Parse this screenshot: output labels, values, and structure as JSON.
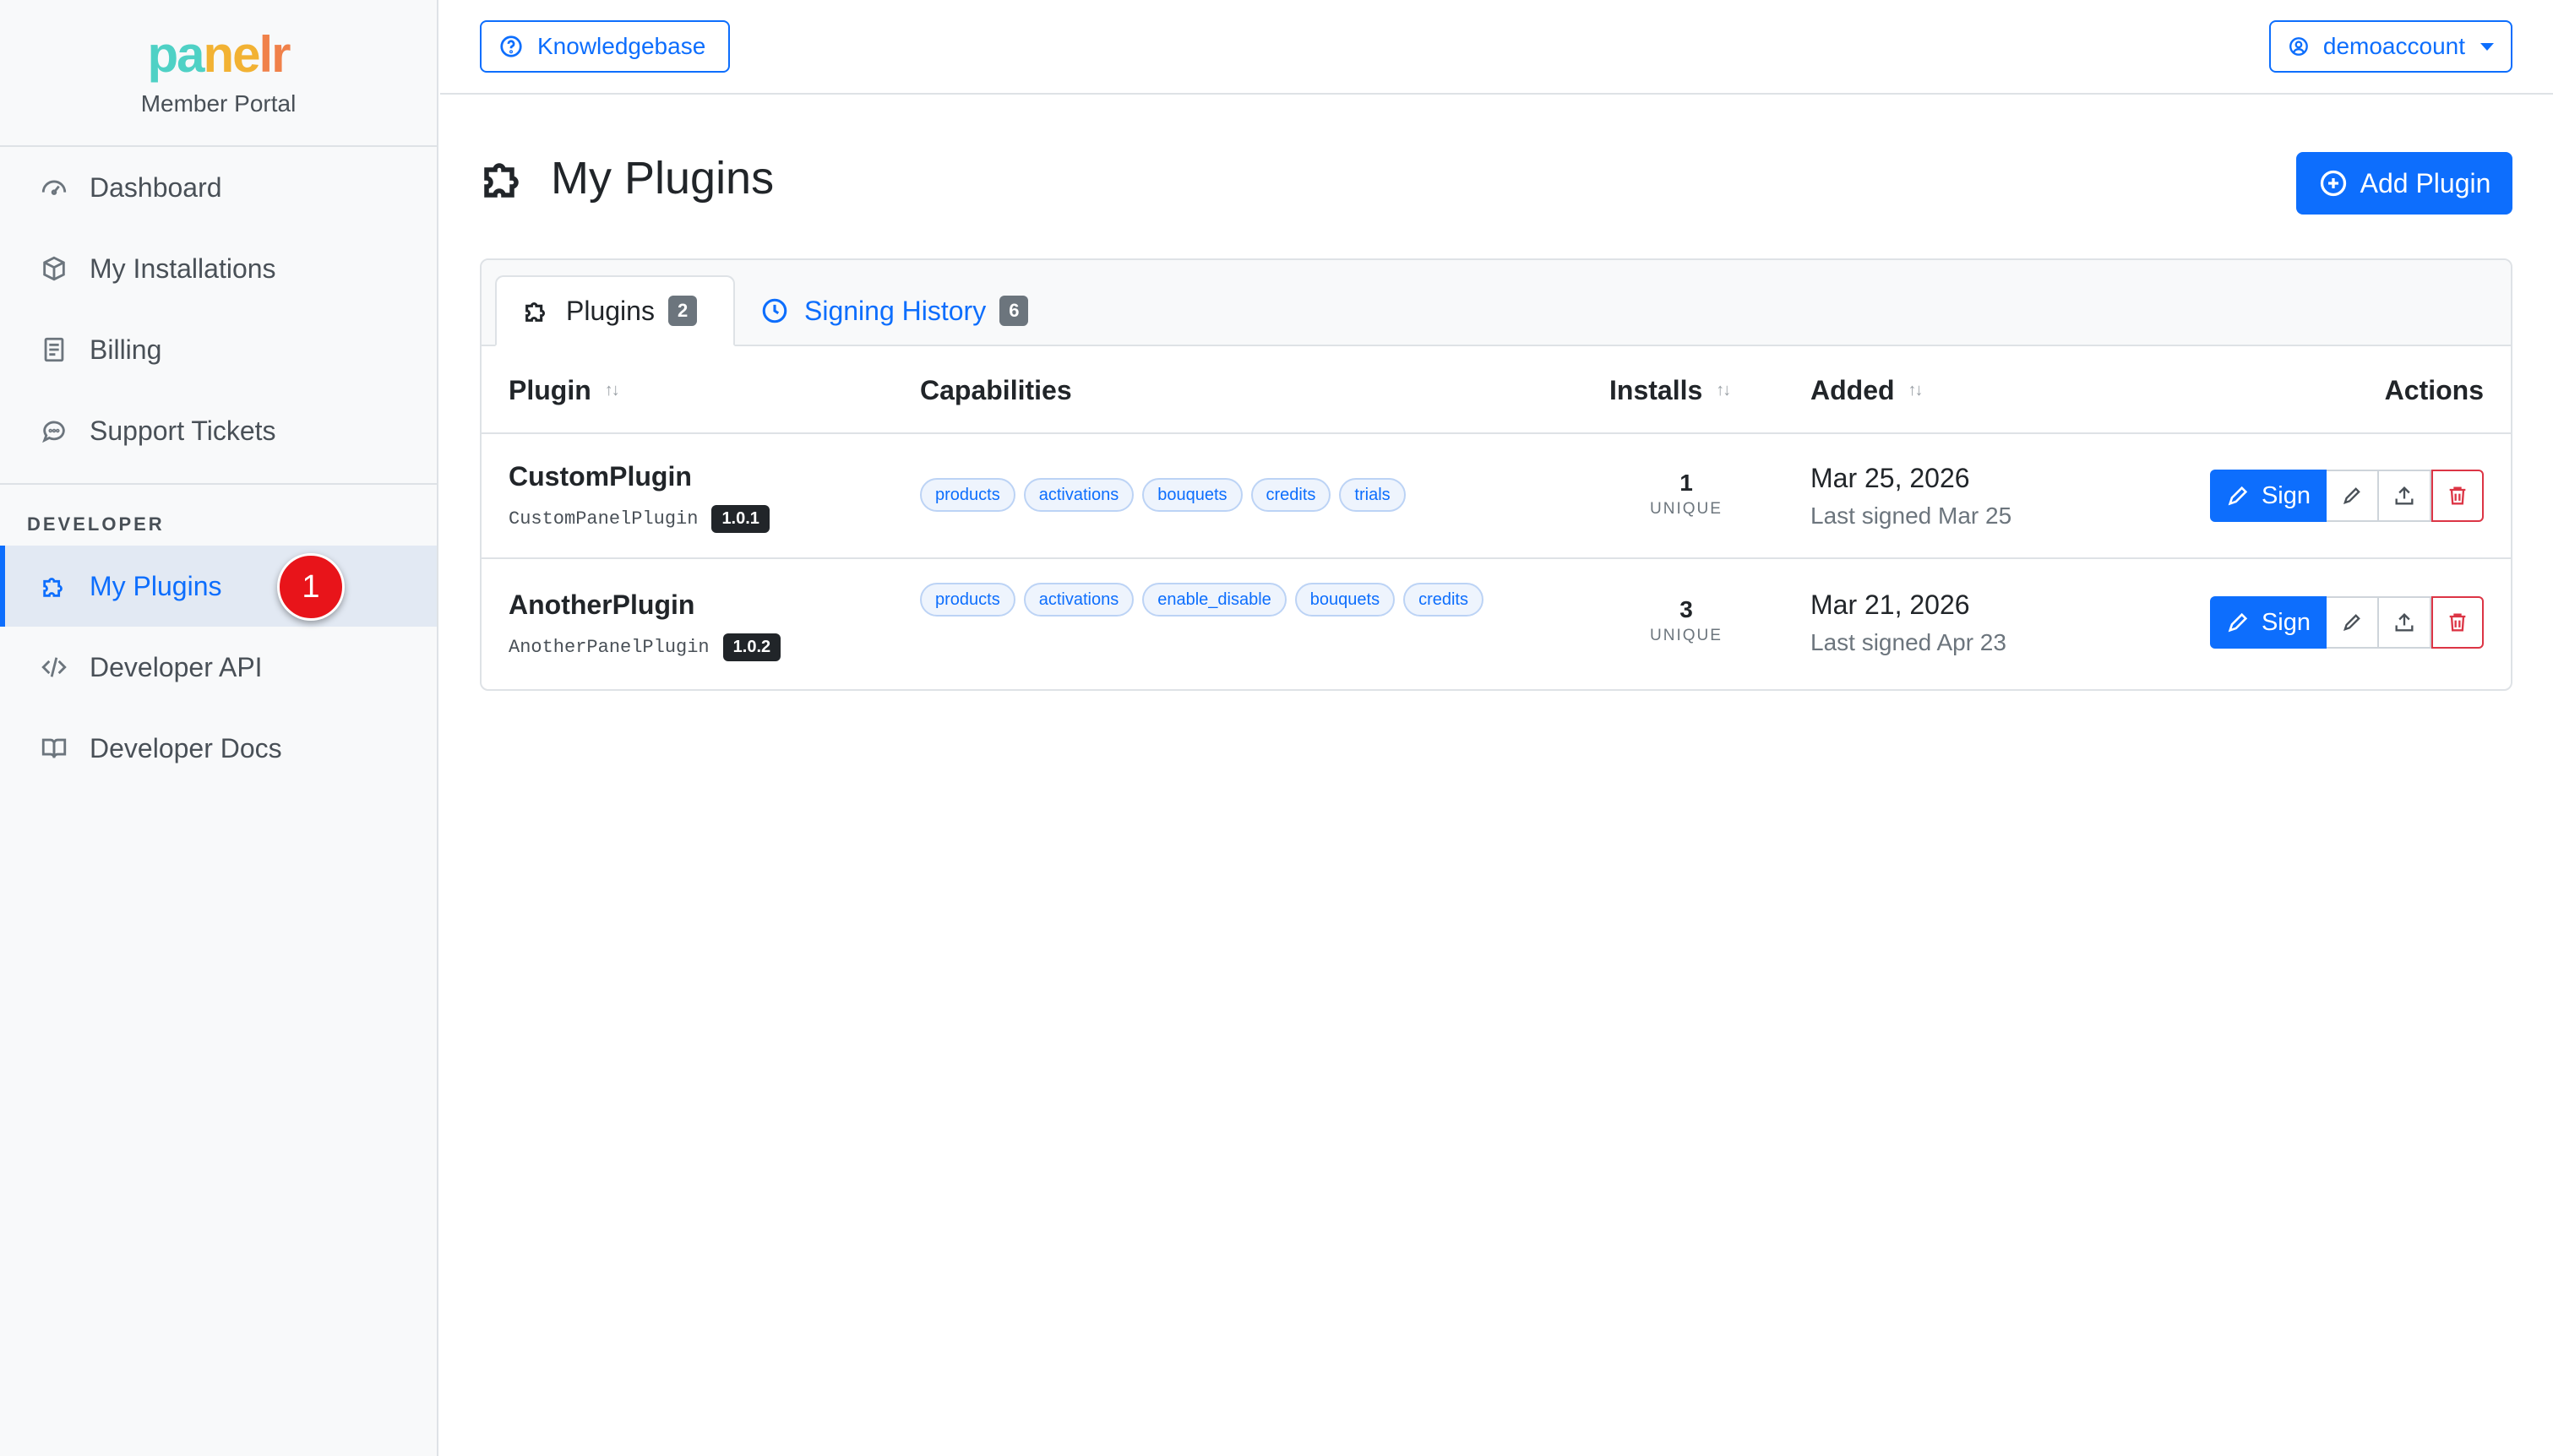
{
  "brand": {
    "logo_part1": "pa",
    "logo_part2": "ne",
    "logo_part3": "lr",
    "subtitle": "Member Portal"
  },
  "sidebar": {
    "items": [
      {
        "label": "Dashboard",
        "icon": "gauge-icon"
      },
      {
        "label": "My Installations",
        "icon": "box-icon"
      },
      {
        "label": "Billing",
        "icon": "receipt-icon"
      },
      {
        "label": "Support Tickets",
        "icon": "chat-icon"
      }
    ],
    "developer_heading": "DEVELOPER",
    "developer_items": [
      {
        "label": "My Plugins",
        "icon": "puzzle-icon",
        "active": true
      },
      {
        "label": "Developer API",
        "icon": "code-icon"
      },
      {
        "label": "Developer Docs",
        "icon": "book-icon"
      }
    ],
    "step_badge": "1"
  },
  "topbar": {
    "knowledgebase_label": "Knowledgebase",
    "account_label": "demoaccount"
  },
  "page": {
    "title": "My Plugins",
    "add_button_label": "Add Plugin"
  },
  "tabs": [
    {
      "label": "Plugins",
      "count": "2",
      "active": true
    },
    {
      "label": "Signing History",
      "count": "6",
      "active": false
    }
  ],
  "table": {
    "headers": {
      "plugin": "Plugin",
      "capabilities": "Capabilities",
      "installs": "Installs",
      "added": "Added",
      "actions": "Actions"
    },
    "sign_label": "Sign",
    "unique_label": "UNIQUE",
    "rows": [
      {
        "name": "CustomPlugin",
        "class_name": "CustomPanelPlugin",
        "version": "1.0.1",
        "capabilities": [
          "products",
          "activations",
          "bouquets",
          "credits",
          "trials"
        ],
        "installs": "1",
        "added": "Mar 25, 2026",
        "last_signed": "Last signed Mar 25"
      },
      {
        "name": "AnotherPlugin",
        "class_name": "AnotherPanelPlugin",
        "version": "1.0.2",
        "capabilities": [
          "products",
          "activations",
          "enable_disable",
          "bouquets",
          "credits"
        ],
        "installs": "3",
        "added": "Mar 21, 2026",
        "last_signed": "Last signed Apr 23"
      }
    ]
  },
  "colors": {
    "primary": "#0d6efd",
    "danger": "#dc3545",
    "sidebar_bg": "#f8f9fa",
    "badge_red": "#e8141a"
  }
}
